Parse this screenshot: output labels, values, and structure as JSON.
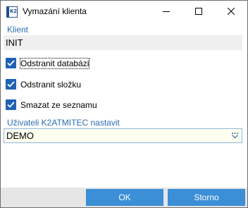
{
  "window": {
    "app_icon_text": "K2",
    "title": "Vymazání klienta"
  },
  "client": {
    "label": "Klient",
    "value": "INIT"
  },
  "options": [
    {
      "label": "Odstranit databázi",
      "checked": true,
      "focused": true
    },
    {
      "label": "Odstranit složku",
      "checked": true,
      "focused": false
    },
    {
      "label": "Smazat ze seznamu",
      "checked": true,
      "focused": false
    }
  ],
  "user_select": {
    "label": "Uživateli K2ATMITEC nastavit",
    "value": "DEMO"
  },
  "buttons": {
    "ok": "OK",
    "cancel": "Storno"
  },
  "colors": {
    "accent": "#1f62b5",
    "label_blue": "#2b6cb5",
    "button_blue": "#3b8fd7",
    "select_bg": "#fffff0",
    "readonly_bg": "#efefef"
  }
}
